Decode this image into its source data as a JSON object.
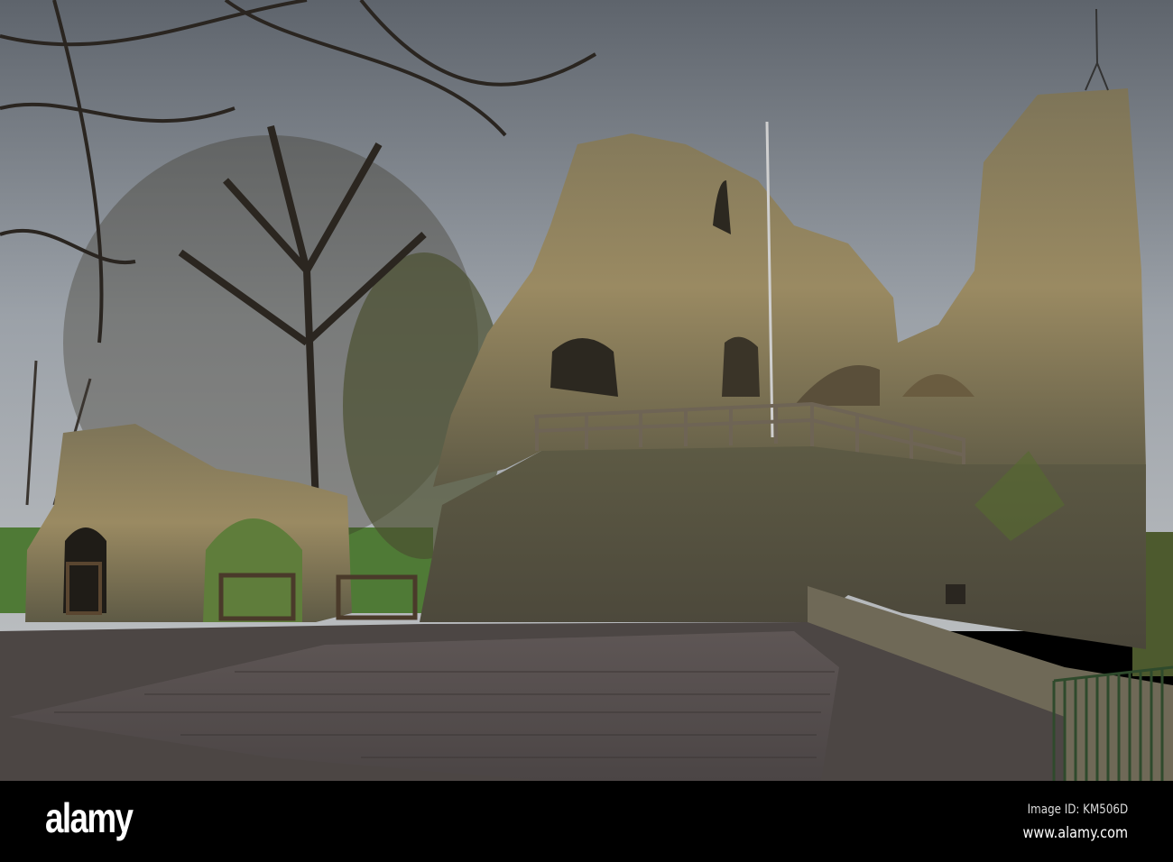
{
  "photo": {
    "subject": "castle-ruins",
    "colors": {
      "sky": "#8c939c",
      "stone": "#8a7a55",
      "paving": "#6e6562",
      "grass": "#4f7a36"
    }
  },
  "watermark": {
    "logo": "alamy",
    "image_id": "Image ID: KM506D",
    "url": "www.alamy.com"
  }
}
